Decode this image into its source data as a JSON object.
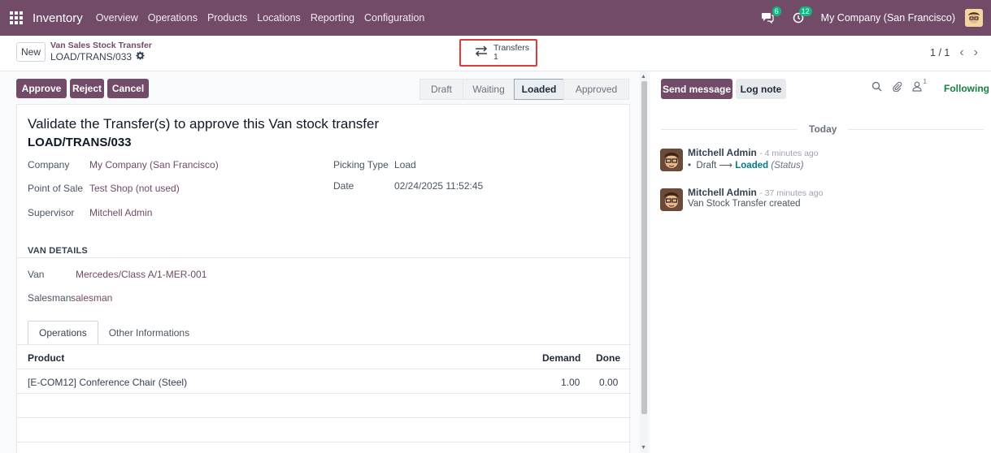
{
  "navbar": {
    "app_name": "Inventory",
    "menu": [
      "Overview",
      "Operations",
      "Products",
      "Locations",
      "Reporting",
      "Configuration"
    ],
    "messages_badge": "6",
    "activities_badge": "12",
    "company": "My Company (San Francisco)"
  },
  "control": {
    "new_label": "New",
    "breadcrumb_parent": "Van Sales Stock Transfer",
    "breadcrumb_current": "LOAD/TRANS/033",
    "smart_button": {
      "label": "Transfers",
      "count": "1"
    },
    "pager": "1 / 1"
  },
  "form": {
    "buttons": {
      "approve": "Approve",
      "reject": "Reject",
      "cancel": "Cancel"
    },
    "stages": [
      "Draft",
      "Waiting",
      "Loaded",
      "Approved"
    ],
    "active_stage": "Loaded",
    "heading": "Validate the Transfer(s) to approve this Van stock transfer",
    "reference": "LOAD/TRANS/033",
    "fields": {
      "company_label": "Company",
      "company_value": "My Company (San Francisco)",
      "pos_label": "Point of Sale",
      "pos_value": "Test Shop (not used)",
      "supervisor_label": "Supervisor",
      "supervisor_value": "Mitchell Admin",
      "picking_type_label": "Picking Type",
      "picking_type_value": "Load",
      "date_label": "Date",
      "date_value": "02/24/2025 11:52:45"
    },
    "van_section": "VAN DETAILS",
    "van_label": "Van",
    "van_value": "Mercedes/Class A/1-MER-001",
    "salesman_label": "Salesman",
    "salesman_value": "salesman",
    "tabs": [
      "Operations",
      "Other Informations"
    ],
    "table": {
      "headers": {
        "product": "Product",
        "demand": "Demand",
        "done": "Done"
      },
      "rows": [
        {
          "product": "[E-COM12] Conference Chair (Steel)",
          "demand": "1.00",
          "done": "0.00"
        }
      ]
    }
  },
  "chatter": {
    "send_message": "Send message",
    "log_note": "Log note",
    "followers_count": "1",
    "following": "Following",
    "today": "Today",
    "messages": [
      {
        "author": "Mitchell Admin",
        "time": "- 4 minutes ago",
        "old_status": "Draft",
        "new_status": "Loaded",
        "field": "(Status)"
      },
      {
        "author": "Mitchell Admin",
        "time": "- 37 minutes ago",
        "body": "Van Stock Transfer created"
      }
    ]
  }
}
